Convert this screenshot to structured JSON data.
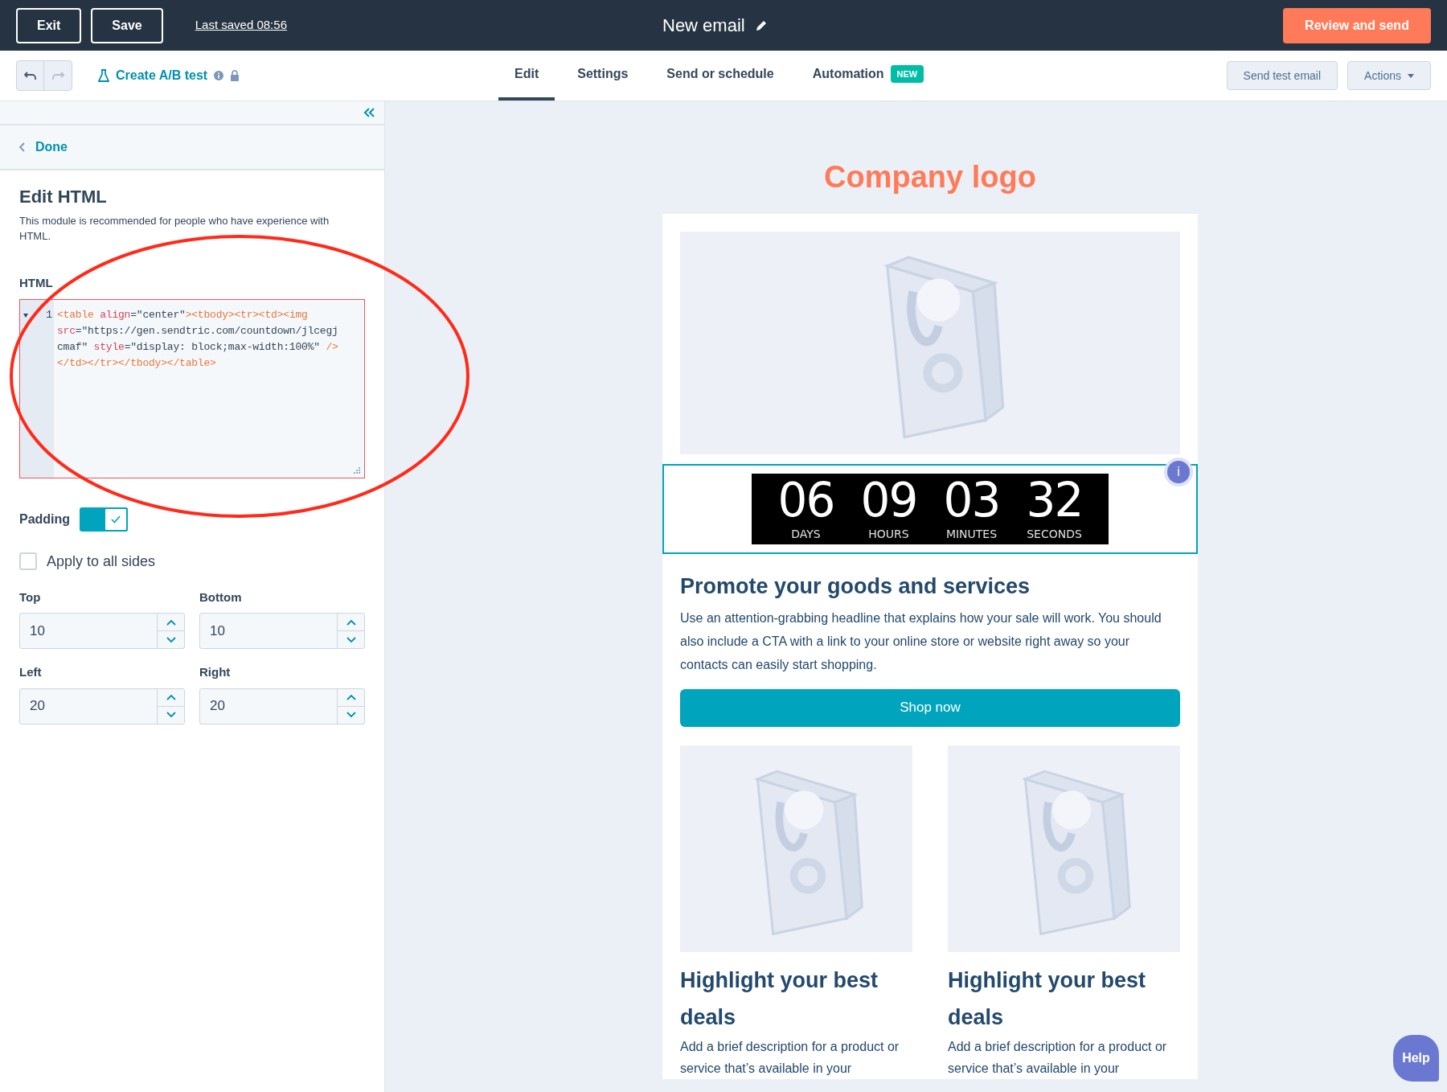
{
  "top_bar": {
    "buttons": [
      "Exit",
      "Save"
    ],
    "last_saved": "Last saved 08:56",
    "title": "New email",
    "primary_button": "Review and send"
  },
  "toolbar": {
    "ab_test": "Create A/B test",
    "tabs": [
      {
        "label": "Edit",
        "selected": true
      },
      {
        "label": "Settings",
        "selected": false
      },
      {
        "label": "Send or schedule",
        "selected": false
      },
      {
        "label": "Automation",
        "selected": false,
        "badge": "NEW"
      }
    ],
    "send_test": "Send test email",
    "actions": "Actions"
  },
  "sidebar": {
    "back": "Done",
    "heading": "Edit HTML",
    "description": "This module is recommended for people who have experience with HTML.",
    "code_label": "HTML",
    "line_number": "1",
    "code_rows": [
      [
        {
          "kind": "tag",
          "text": "<table "
        },
        {
          "kind": "attr",
          "text": "align"
        },
        {
          "kind": "text",
          "text": "=\"center\""
        },
        {
          "kind": "tag",
          "text": "><tbody><tr><td><img"
        }
      ],
      [
        {
          "kind": "attr",
          "text": "src"
        },
        {
          "kind": "text",
          "text": "=\"https://gen.sendtric.com/countdown/jlcegj"
        }
      ],
      [
        {
          "kind": "text",
          "text": "cmaf\" "
        },
        {
          "kind": "attr",
          "text": "style"
        },
        {
          "kind": "text",
          "text": "=\"display: block;max-width:100%\" "
        },
        {
          "kind": "tag",
          "text": "/>"
        }
      ],
      [
        {
          "kind": "tag",
          "text": "</td></tr></tbody></table>"
        }
      ]
    ],
    "padding": {
      "label": "Padding",
      "on": true
    },
    "apply_all": {
      "label": "Apply to all sides",
      "checked": false
    },
    "fields": [
      {
        "label": "Top",
        "value": "10"
      },
      {
        "label": "Bottom",
        "value": "10"
      },
      {
        "label": "Left",
        "value": "20"
      },
      {
        "label": "Right",
        "value": "20"
      }
    ]
  },
  "email": {
    "logo": "Company logo",
    "countdown": [
      {
        "value": "06",
        "unit": "DAYS"
      },
      {
        "value": "09",
        "unit": "HOURS"
      },
      {
        "value": "03",
        "unit": "MINUTES"
      },
      {
        "value": "32",
        "unit": "SECONDS"
      }
    ],
    "info_badge": "i",
    "heading": "Promote your goods and services",
    "body": "Use an attention-grabbing headline that explains how your sale will work. You should also include a CTA with a link to your online store or website right away so your contacts can easily start shopping.",
    "button": "Shop now",
    "cards": [
      {
        "heading": "Highlight your best deals",
        "text": "Add a brief description for a product or service that’s available in your"
      },
      {
        "heading": "Highlight your best deals",
        "text": "Add a brief description for a product or service that’s available in your"
      }
    ]
  },
  "help": "Help"
}
